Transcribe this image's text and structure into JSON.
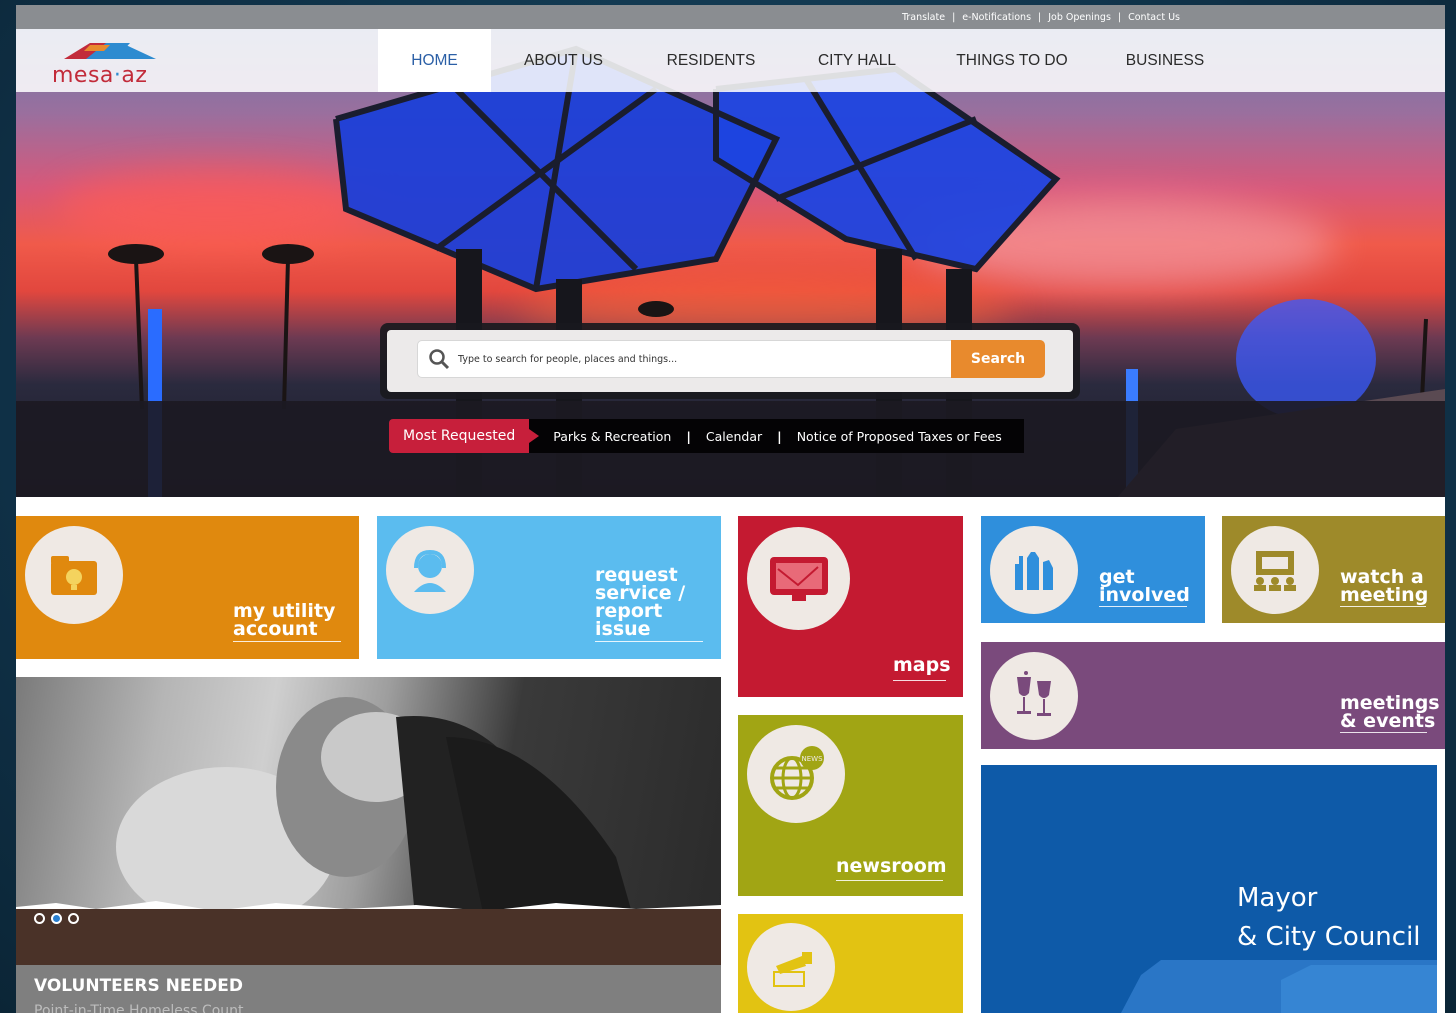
{
  "utility_links": [
    "Translate",
    "e-Notifications",
    "Job Openings",
    "Contact Us"
  ],
  "logo": {
    "text_main": "mesa",
    "text_dot": "·",
    "text_end": "az"
  },
  "nav": {
    "items": [
      "HOME",
      "ABOUT US",
      "RESIDENTS",
      "CITY HALL",
      "THINGS TO DO",
      "BUSINESS"
    ],
    "active": "HOME"
  },
  "search": {
    "placeholder": "Type to search for people, places and things...",
    "button": "Search"
  },
  "most_requested": {
    "label": "Most Requested",
    "links": [
      "Parks & Recreation",
      "Calendar",
      "Notice of Proposed Taxes or Fees"
    ],
    "separator": "|"
  },
  "tiles": {
    "utility": {
      "line1": "my utility",
      "line2": "account",
      "color": "#e0890e"
    },
    "request": {
      "line1": "request",
      "line2": "service /",
      "line3": "report",
      "line4": "issue",
      "color": "#5bbcef"
    },
    "maps": {
      "label": "maps",
      "color": "#c41a31"
    },
    "get_involved": {
      "line1": "get",
      "line2": "involved",
      "color": "#2f8fdc"
    },
    "watch": {
      "line1": "watch a",
      "line2": "meeting",
      "color": "#9e8a2a"
    },
    "meetings": {
      "line1": "meetings",
      "line2": "& events",
      "color": "#7a4a7c"
    },
    "newsroom": {
      "label": "newsroom",
      "icon_badge": "NEWS",
      "color": "#a1a514"
    },
    "yellow": {
      "color": "#e2c312"
    },
    "council": {
      "line1": "Mayor",
      "line2": "& City Council",
      "color": "#0e5aa8"
    }
  },
  "slider": {
    "title": "VOLUNTEERS NEEDED",
    "subtitle": "Point-in-Time Homeless Count",
    "active_dot": 2,
    "dot_count": 3
  }
}
